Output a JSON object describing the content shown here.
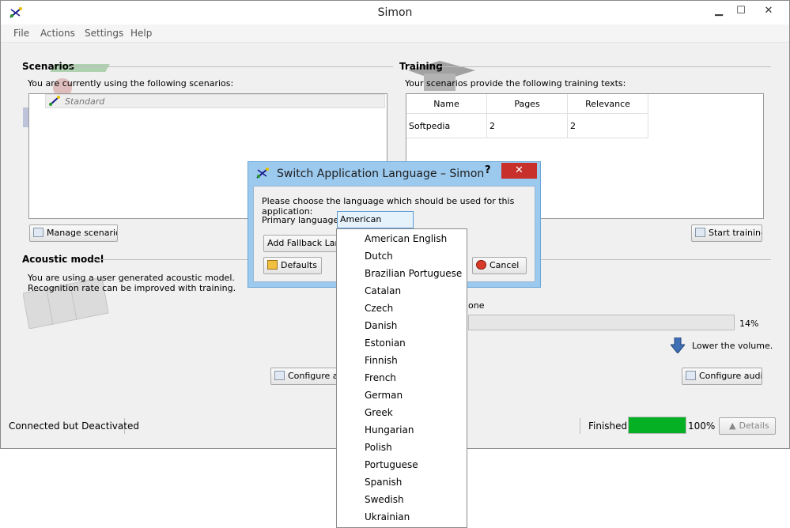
{
  "window": {
    "title": "Simon"
  },
  "menu": [
    "File",
    "Actions",
    "Settings",
    "Help"
  ],
  "scenarios": {
    "heading": "Scenarios",
    "desc": "You are currently using the following scenarios:",
    "items": [
      "Standard"
    ],
    "manage_button": "Manage scenarios"
  },
  "training": {
    "heading": "Training",
    "desc": "Your scenarios provide the following training texts:",
    "columns": [
      "Name",
      "Pages",
      "Relevance"
    ],
    "rows": [
      [
        "Softpedia",
        "2",
        "2"
      ]
    ],
    "start_button": "Start training"
  },
  "acoustic": {
    "heading": "Acoustic model",
    "line1": "You are using a user generated acoustic model.",
    "line2": "Recognition rate can be improved with training.",
    "configure_button": "Configure ac"
  },
  "audio": {
    "mic_partial": "one",
    "level": "14%",
    "hint": "Lower the volume.",
    "configure_button": "Configure audio"
  },
  "status": {
    "connection": "Connected but Deactivated",
    "task": "Finished",
    "progress": "100%",
    "details_button": "Details"
  },
  "dialog": {
    "title": "Switch Application Language – Simon",
    "help": "?",
    "prompt": "Please choose the language which should be used for this application:",
    "primary_label": "Primary language:",
    "selected": "American English",
    "fallback_button": "Add Fallback Langu",
    "defaults_button": "Defaults",
    "cancel_button": "Cancel",
    "options": [
      "American English",
      "Dutch",
      "Brazilian Portuguese",
      "Catalan",
      "Czech",
      "Danish",
      "Estonian",
      "Finnish",
      "French",
      "German",
      "Greek",
      "Hungarian",
      "Polish",
      "Portuguese",
      "Spanish",
      "Swedish",
      "Ukrainian"
    ]
  },
  "colors": {
    "progress": "#06b025",
    "dialog_frame": "#9cc9ee",
    "close": "#c7302b"
  }
}
